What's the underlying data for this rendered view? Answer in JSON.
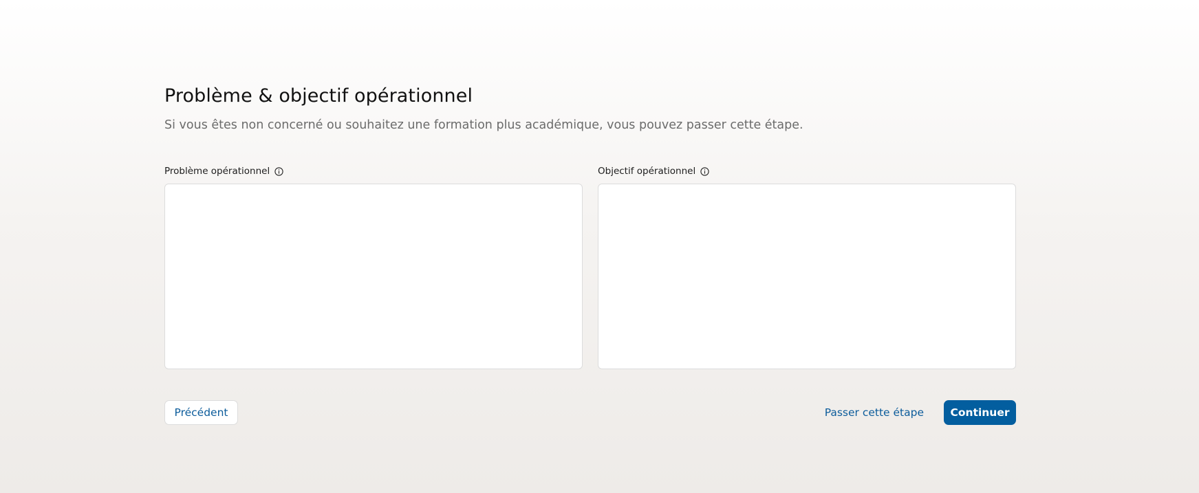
{
  "header": {
    "title": "Problème & objectif opérationnel",
    "subtitle": "Si vous êtes non concerné ou souhaitez une formation plus académique, vous pouvez passer cette étape."
  },
  "fields": [
    {
      "label": "Problème opérationnel",
      "icon": "info-icon",
      "value": "",
      "placeholder": ""
    },
    {
      "label": "Objectif opérationnel",
      "icon": "info-icon",
      "value": "",
      "placeholder": ""
    }
  ],
  "actions": {
    "previous_label": "Précédent",
    "skip_label": "Passer cette étape",
    "continue_label": "Continuer"
  },
  "colors": {
    "accent": "#035e9f",
    "link": "#0c5c9b",
    "subtitle": "#6b6b6b",
    "border": "#dcdcdc"
  }
}
